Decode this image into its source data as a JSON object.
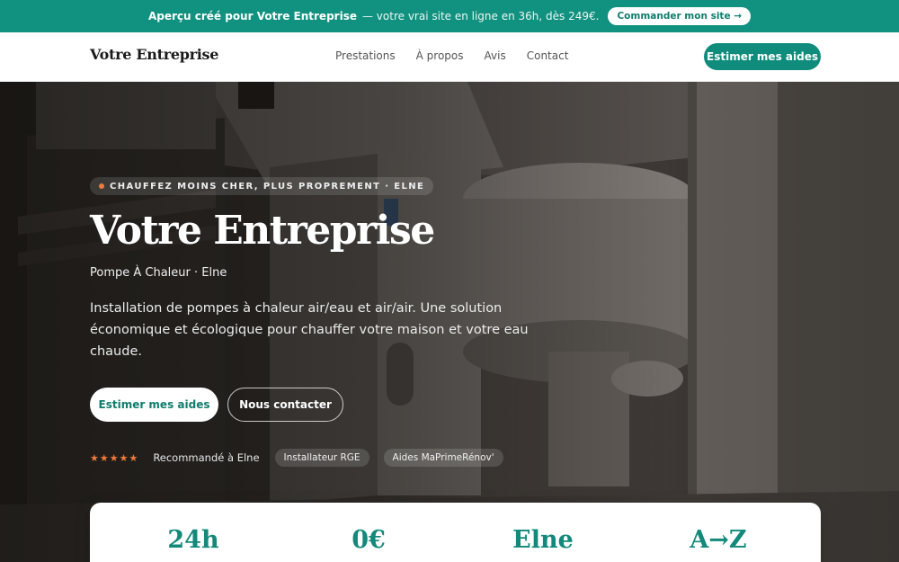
{
  "banner": {
    "strong": "Aperçu créé pour Votre Entreprise",
    "rest": "— votre vrai site en ligne en 36h, dès 249€.",
    "cta": "Commander mon site →"
  },
  "header": {
    "brand": "Votre Entreprise",
    "nav": [
      "Prestations",
      "À propos",
      "Avis",
      "Contact"
    ],
    "cta": "Estimer mes aides"
  },
  "hero": {
    "kicker": "CHAUFFEZ MOINS CHER, PLUS PROPREMENT · ELNE",
    "title": "Votre Entreprise",
    "subtitle": "Pompe À Chaleur · Elne",
    "lede": "Installation de pompes à chaleur air/eau et air/air. Une solution économique et écologique pour chauffer votre maison et votre eau chaude.",
    "primary_cta": "Estimer mes aides",
    "secondary_cta": "Nous contacter",
    "stars": "★★★★★",
    "recommended": "Recommandé à Elne",
    "badges": [
      "Installateur RGE",
      "Aides MaPrimeRénov'"
    ]
  },
  "stats": [
    "24h",
    "0€",
    "Elne",
    "A→Z"
  ],
  "colors": {
    "brand": "#0f8c7b",
    "accent": "#ef7a3a"
  }
}
